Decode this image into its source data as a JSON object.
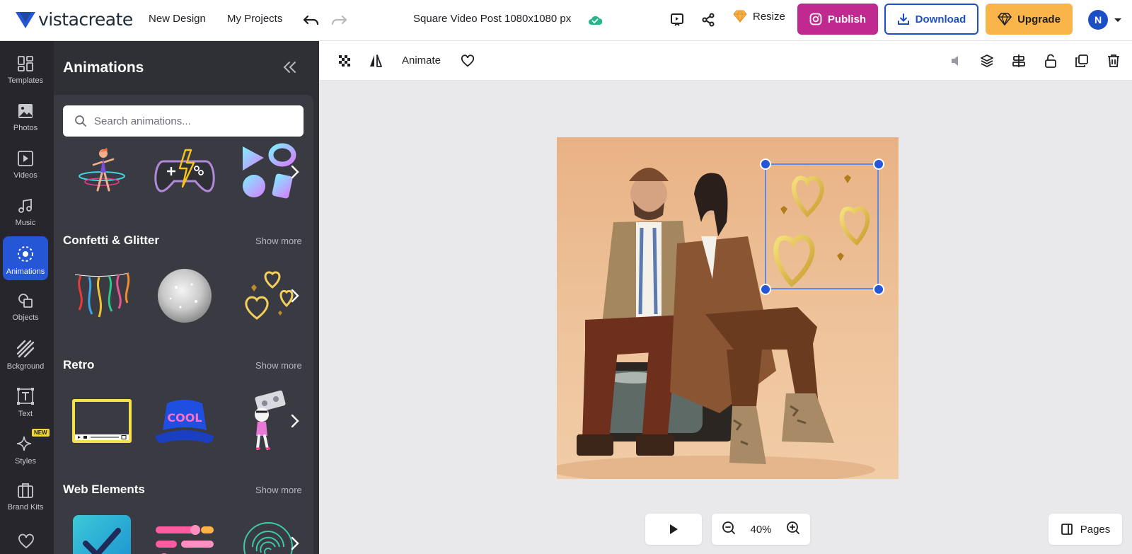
{
  "brand": {
    "name": "vistacreate",
    "accent": "#2456d6",
    "publish_color": "#c0298f",
    "upgrade_color": "#f9b44a"
  },
  "topbar": {
    "new_design": "New Design",
    "my_projects": "My Projects",
    "doc_title": "Square Video Post 1080x1080 px",
    "resize": "Resize",
    "publish": "Publish",
    "download": "Download",
    "upgrade": "Upgrade",
    "avatar_initial": "N"
  },
  "rail": {
    "items": [
      {
        "label": "Templates",
        "icon": "templates-icon"
      },
      {
        "label": "Photos",
        "icon": "photo-icon"
      },
      {
        "label": "Videos",
        "icon": "video-icon"
      },
      {
        "label": "Music",
        "icon": "music-icon"
      },
      {
        "label": "Animations",
        "icon": "animation-icon",
        "active": true
      },
      {
        "label": "Objects",
        "icon": "objects-icon"
      },
      {
        "label": "Bckground",
        "icon": "background-icon"
      },
      {
        "label": "Text",
        "icon": "text-icon"
      },
      {
        "label": "Styles",
        "icon": "sparkle-icon"
      },
      {
        "label": "Brand Kits",
        "icon": "briefcase-icon"
      }
    ],
    "new_badge": "NEW"
  },
  "panel": {
    "title": "Animations",
    "search_placeholder": "Search animations...",
    "sections": [
      {
        "title": "Confetti & Glitter",
        "show_more": "Show more"
      },
      {
        "title": "Retro",
        "show_more": "Show more"
      },
      {
        "title": "Web Elements",
        "show_more": "Show more"
      }
    ],
    "retro_cap_text": "COOL"
  },
  "toolbar2": {
    "animate": "Animate"
  },
  "canvas": {
    "zoom": "40%",
    "pages": "Pages"
  }
}
